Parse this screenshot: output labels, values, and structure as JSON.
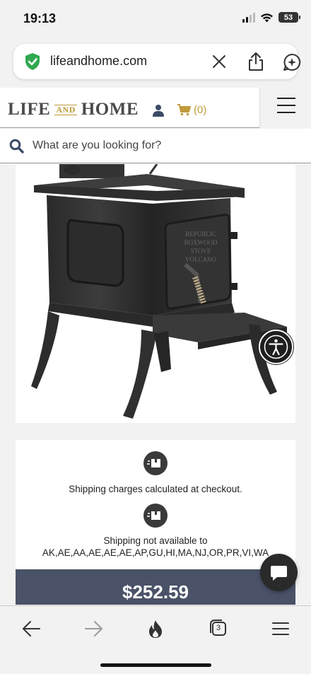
{
  "status_bar": {
    "time": "19:13",
    "battery": "53"
  },
  "browser": {
    "url": "lifeandhome.com",
    "tab_count": "3"
  },
  "site": {
    "logo_left": "LIFE",
    "logo_and": "AND",
    "logo_right": "HOME",
    "cart_count": "(0)",
    "search_placeholder": "What are you looking for?"
  },
  "product": {
    "shipping_note": "Shipping charges calculated at checkout.",
    "shipping_unavailable_line1": "Shipping not available to",
    "shipping_unavailable_line2": "AK,AE,AA,AE,AE,AE,AP,GU,HI,MA,NJ,OR,PR,VI,WA",
    "price": "$252.59"
  },
  "colors": {
    "brand_gold": "#c09a3a",
    "price_bar": "#4a5268",
    "secure_green": "#2fa84f"
  },
  "icons": [
    "signal-icon",
    "wifi-icon",
    "battery-icon",
    "shield-check-icon",
    "close-icon",
    "share-icon",
    "assistant-icon",
    "user-icon",
    "cart-icon",
    "hamburger-icon",
    "search-icon",
    "accessibility-icon",
    "shipping-box-icon",
    "chat-icon",
    "back-icon",
    "forward-icon",
    "flame-icon",
    "tabs-icon",
    "menu-icon"
  ]
}
